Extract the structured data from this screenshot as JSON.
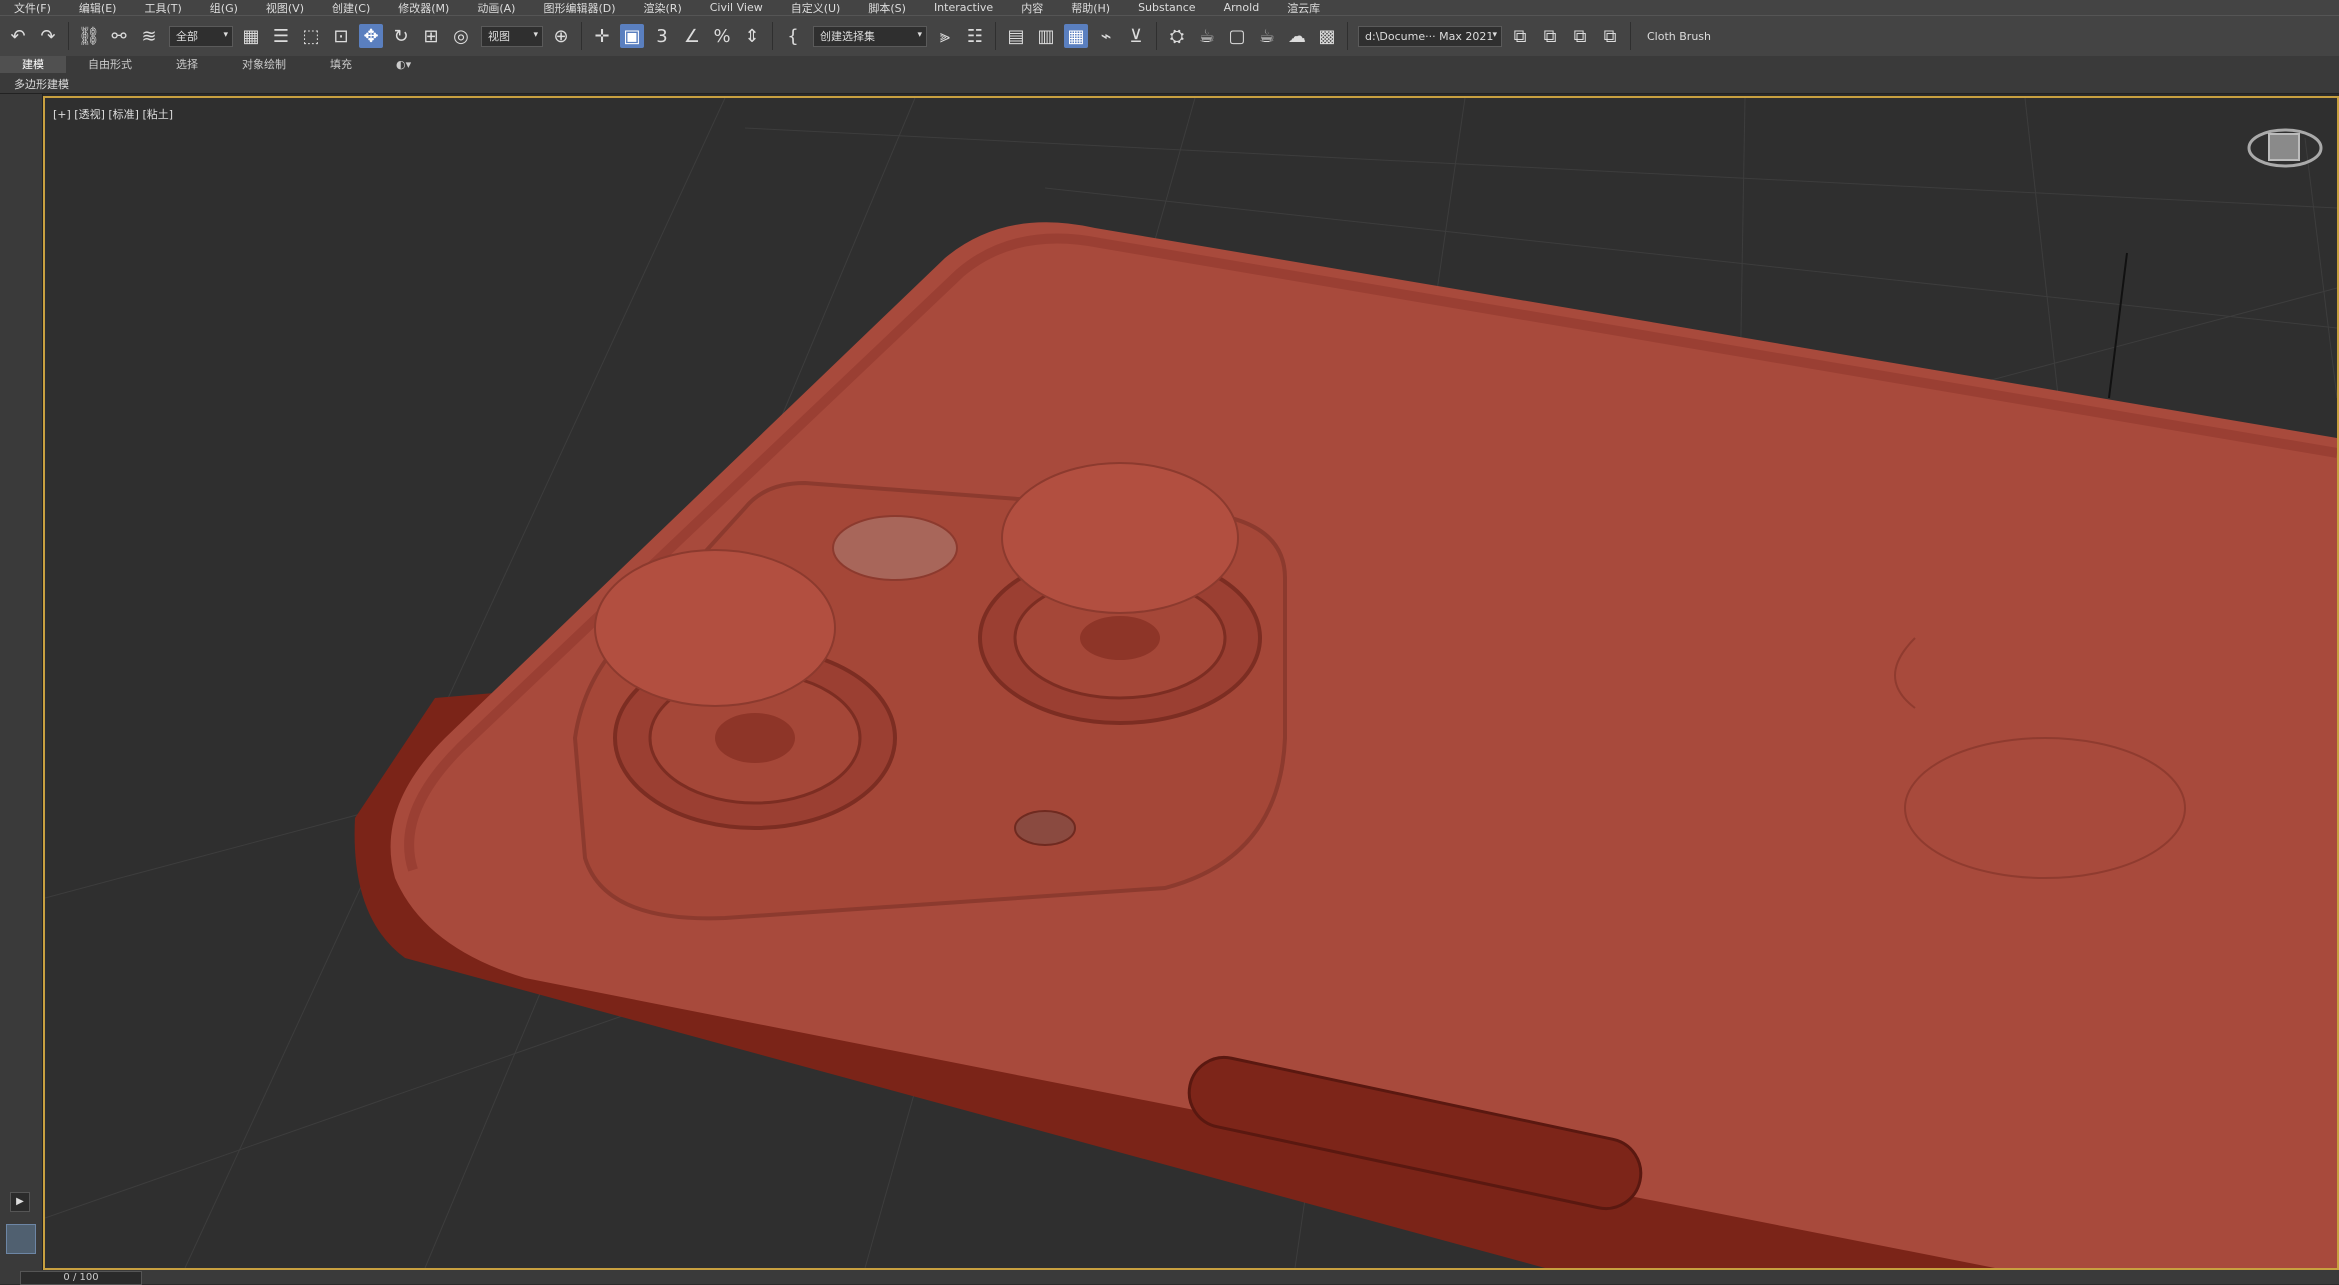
{
  "menu": [
    "文件(F)",
    "编辑(E)",
    "工具(T)",
    "组(G)",
    "视图(V)",
    "创建(C)",
    "修改器(M)",
    "动画(A)",
    "图形编辑器(D)",
    "渲染(R)",
    "Civil View",
    "自定义(U)",
    "脚本(S)",
    "Interactive",
    "内容",
    "帮助(H)",
    "Substance",
    "Arnold",
    "渲云库"
  ],
  "toolbar": {
    "selection_filter": "全部",
    "ref_coord": "视图",
    "named_selection": "创建选择集",
    "project_path": "d:\\Docume··· Max 2021",
    "cloth_label": "Cloth Brush"
  },
  "ribbon": {
    "tabs": [
      "建模",
      "自由形式",
      "选择",
      "对象绘制",
      "填充"
    ],
    "selected": "建模"
  },
  "subribbon_label": "多边形建模",
  "viewport": {
    "label": "[+] [透视] [标准] [粘土]"
  },
  "timeline": {
    "current": "0 / 100"
  },
  "colors": {
    "accent": "#5a7fbf",
    "viewport_border": "#c8a040",
    "model": "#a84a3c"
  }
}
